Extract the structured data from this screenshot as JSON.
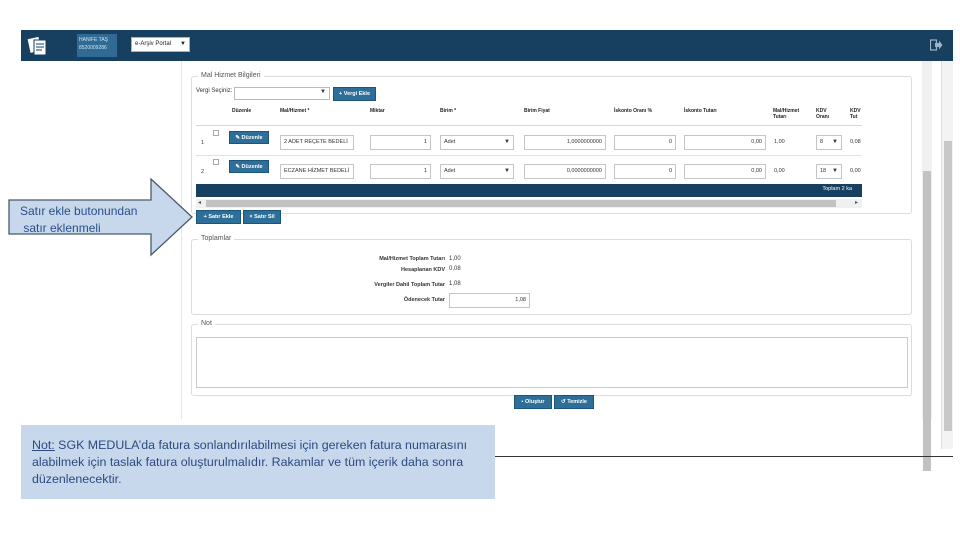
{
  "topbar": {
    "user_name": "HANIFE TAŞ",
    "user_id": "8520009286",
    "portal_select": "e-Arşiv Portal",
    "bg_color": "#173f5f"
  },
  "mal_hizmet": {
    "legend": "Mal Hizmet Bilgileri",
    "vergi_label": "Vergi Seçiniz:",
    "vergi_ekle": "Vergi Ekle",
    "headers": [
      "Düzenle",
      "Mal/Hizmet *",
      "Miktar",
      "Birim *",
      "Birim Fiyat",
      "İskonto Oranı %",
      "İskonto Tutarı",
      "Mal/Hizmet Tutarı",
      "KDV Oranı",
      "KDV Tut"
    ],
    "rows": [
      {
        "no": "1",
        "edit": "Düzenle",
        "name": "2 ADET REÇETE BEDELİ",
        "qty": "1",
        "unit": "Adet",
        "price": "1,0000000000",
        "disc_rate": "0",
        "disc_amt": "0,00",
        "amount": "1,00",
        "kdv_rate": "8",
        "kdv_amt": "0,08"
      },
      {
        "no": "2",
        "edit": "Düzenle",
        "name": "ECZANE HİZMET BEDELİ",
        "qty": "1",
        "unit": "Adet",
        "price": "0,0000000000",
        "disc_rate": "0",
        "disc_amt": "0,00",
        "amount": "0,00",
        "kdv_rate": "18",
        "kdv_amt": "0,00"
      }
    ],
    "footer": "Toplam 2 ka",
    "satir_ekle": "Satır Ekle",
    "satir_sil": "Satır Sil"
  },
  "toplamlar": {
    "legend": "Toplamlar",
    "items": [
      {
        "label": "Mal/Hizmet Toplam Tutarı",
        "value": "1,00"
      },
      {
        "label": "Hesaplanan KDV",
        "value": "0,08"
      },
      {
        "label": "Vergiler Dahil Toplam Tutar",
        "value": "1,08"
      },
      {
        "label": "Ödenecek Tutar",
        "value": "1,08"
      }
    ]
  },
  "not": {
    "legend": "Not"
  },
  "actions": {
    "olustur": "Oluştur",
    "temizle": "Temizle"
  },
  "callout": {
    "line1": "Satır ekle butonundan",
    "line2": " satır eklenmeli"
  },
  "note": {
    "prefix": "Not:",
    "text": " SGK MEDULA’da fatura sonlandırılabilmesi için gereken  fatura numarasını alabilmek için taslak fatura oluşturulmalıdır.  Rakamlar ve tüm içerik daha sonra düzenlenecektir."
  }
}
